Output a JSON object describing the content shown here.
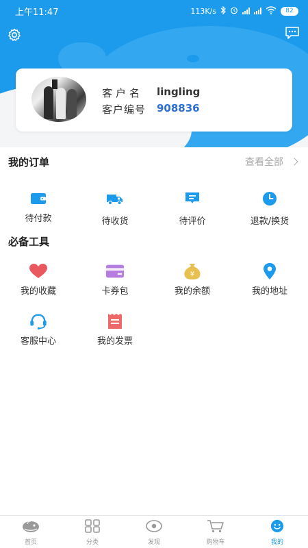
{
  "status_bar": {
    "time": "上午11:47",
    "speed": "113K/s",
    "battery": "82"
  },
  "profile": {
    "name_label": "客户名",
    "name_value": "lingling",
    "id_label": "客户编号",
    "id_value": "908836"
  },
  "orders": {
    "title": "我的订单",
    "view_all": "查看全部",
    "items": [
      {
        "label": "待付款",
        "icon": "wallet-icon"
      },
      {
        "label": "待收货",
        "icon": "truck-icon"
      },
      {
        "label": "待评价",
        "icon": "comment-icon"
      },
      {
        "label": "退款/换货",
        "icon": "clock-icon"
      }
    ]
  },
  "tools": {
    "title": "必备工具",
    "items": [
      {
        "label": "我的收藏",
        "icon": "heart-icon"
      },
      {
        "label": "卡券包",
        "icon": "card-icon"
      },
      {
        "label": "我的余额",
        "icon": "money-bag-icon"
      },
      {
        "label": "我的地址",
        "icon": "location-pin-icon"
      },
      {
        "label": "客服中心",
        "icon": "headset-icon"
      },
      {
        "label": "我的发票",
        "icon": "invoice-icon"
      }
    ]
  },
  "bottom_nav": {
    "items": [
      {
        "label": "首页",
        "icon": "home-fish-icon",
        "active": false
      },
      {
        "label": "分类",
        "icon": "grid-icon",
        "active": false
      },
      {
        "label": "发现",
        "icon": "eye-icon",
        "active": false
      },
      {
        "label": "购物车",
        "icon": "cart-icon",
        "active": false
      },
      {
        "label": "我的",
        "icon": "smiley-icon",
        "active": true
      }
    ]
  },
  "colors": {
    "brand_blue": "#1c9aec",
    "link_blue": "#2d6fd0",
    "heart_red": "#e8585e",
    "card_purple": "#b67de0",
    "bag_gold": "#e8c050",
    "invoice_red": "#ec6a6a"
  }
}
